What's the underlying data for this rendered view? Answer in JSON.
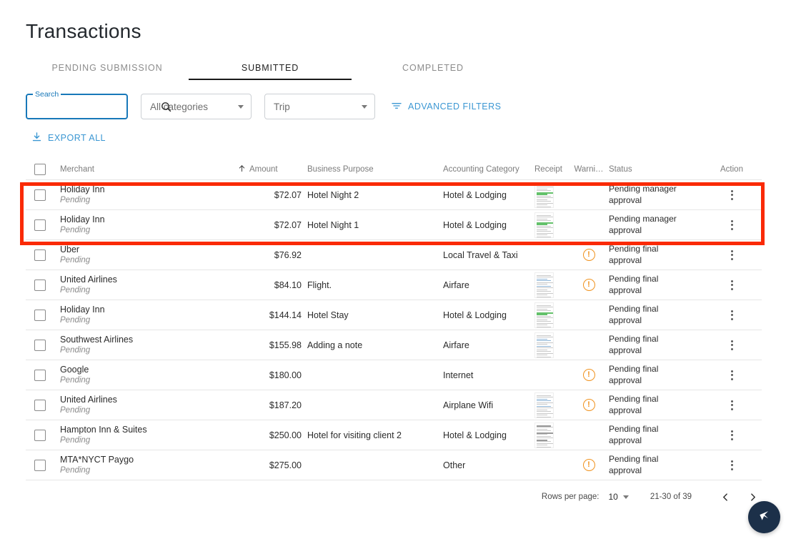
{
  "page": {
    "title": "Transactions"
  },
  "tabs": [
    {
      "label": "PENDING SUBMISSION",
      "active": false
    },
    {
      "label": "SUBMITTED",
      "active": true
    },
    {
      "label": "COMPLETED",
      "active": false
    }
  ],
  "filters": {
    "search": {
      "legend": "Search",
      "value": "",
      "placeholder": "",
      "icon": "search-icon"
    },
    "category_select": {
      "value": "All categories",
      "icon": "chevron-down-icon"
    },
    "trip_select": {
      "value": "Trip",
      "icon": "chevron-down-icon"
    },
    "advanced_filters": {
      "label": "ADVANCED FILTERS",
      "icon": "filter-icon",
      "color": "#3b97d3"
    }
  },
  "export": {
    "label": "EXPORT ALL",
    "icon": "download-icon",
    "color": "#3b97d3"
  },
  "table": {
    "columns": {
      "select": "",
      "merchant": "Merchant",
      "amount": "Amount",
      "business_purpose": "Business Purpose",
      "accounting_category": "Accounting Category",
      "receipt": "Receipt",
      "warning": "Warni…",
      "status": "Status",
      "action": "Action"
    },
    "sort": {
      "column": "amount",
      "direction": "asc",
      "icon": "arrow-up-icon"
    },
    "rows": [
      {
        "merchant": "Holiday Inn",
        "sub": "Pending",
        "amount": "$72.07",
        "business_purpose": "Hotel Night 2",
        "accounting_category": "Hotel & Lodging",
        "receipt": true,
        "receipt_style": "green",
        "warning": false,
        "status": "Pending manager approval",
        "highlighted": true
      },
      {
        "merchant": "Holiday Inn",
        "sub": "Pending",
        "amount": "$72.07",
        "business_purpose": "Hotel Night 1",
        "accounting_category": "Hotel & Lodging",
        "receipt": true,
        "receipt_style": "green",
        "warning": false,
        "status": "Pending manager approval",
        "highlighted": true
      },
      {
        "merchant": "Uber",
        "sub": "Pending",
        "amount": "$76.92",
        "business_purpose": "",
        "accounting_category": "Local Travel & Taxi",
        "receipt": false,
        "receipt_style": "",
        "warning": true,
        "status": "Pending final approval",
        "highlighted": false
      },
      {
        "merchant": "United Airlines",
        "sub": "Pending",
        "amount": "$84.10",
        "business_purpose": "Flight.",
        "accounting_category": "Airfare",
        "receipt": true,
        "receipt_style": "blue",
        "warning": true,
        "status": "Pending final approval",
        "highlighted": false
      },
      {
        "merchant": "Holiday Inn",
        "sub": "Pending",
        "amount": "$144.14",
        "business_purpose": "Hotel Stay",
        "accounting_category": "Hotel & Lodging",
        "receipt": true,
        "receipt_style": "green",
        "warning": false,
        "status": "Pending final approval",
        "highlighted": false
      },
      {
        "merchant": "Southwest Airlines",
        "sub": "Pending",
        "amount": "$155.98",
        "business_purpose": "Adding a note",
        "accounting_category": "Airfare",
        "receipt": true,
        "receipt_style": "blue",
        "warning": false,
        "status": "Pending final approval",
        "highlighted": false
      },
      {
        "merchant": "Google",
        "sub": "Pending",
        "amount": "$180.00",
        "business_purpose": "",
        "accounting_category": "Internet",
        "receipt": false,
        "receipt_style": "",
        "warning": true,
        "status": "Pending final approval",
        "highlighted": false
      },
      {
        "merchant": "United Airlines",
        "sub": "Pending",
        "amount": "$187.20",
        "business_purpose": "",
        "accounting_category": "Airplane Wifi",
        "receipt": true,
        "receipt_style": "blue",
        "warning": true,
        "status": "Pending final approval",
        "highlighted": false
      },
      {
        "merchant": "Hampton Inn & Suites",
        "sub": "Pending",
        "amount": "$250.00",
        "business_purpose": "Hotel for visiting client 2",
        "accounting_category": "Hotel & Lodging",
        "receipt": true,
        "receipt_style": "dark",
        "warning": false,
        "status": "Pending final approval",
        "highlighted": false
      },
      {
        "merchant": "MTA*NYCT Paygo",
        "sub": "Pending",
        "amount": "$275.00",
        "business_purpose": "",
        "accounting_category": "Other",
        "receipt": false,
        "receipt_style": "",
        "warning": true,
        "status": "Pending final approval",
        "highlighted": false
      }
    ]
  },
  "pagination": {
    "rows_per_page_label": "Rows per page:",
    "rows_per_page_value": "10",
    "range": "21-30 of 39",
    "prev_icon": "chevron-left-icon",
    "next_icon": "chevron-right-icon"
  },
  "fab": {
    "icon": "send-message-icon",
    "color": "#1c3049"
  },
  "colors": {
    "accent_blue": "#3b97d3",
    "focus_blue": "#1878b9",
    "warning_orange": "#f0921e",
    "highlight_red": "#fa2a05",
    "fab_navy": "#1c3049"
  }
}
